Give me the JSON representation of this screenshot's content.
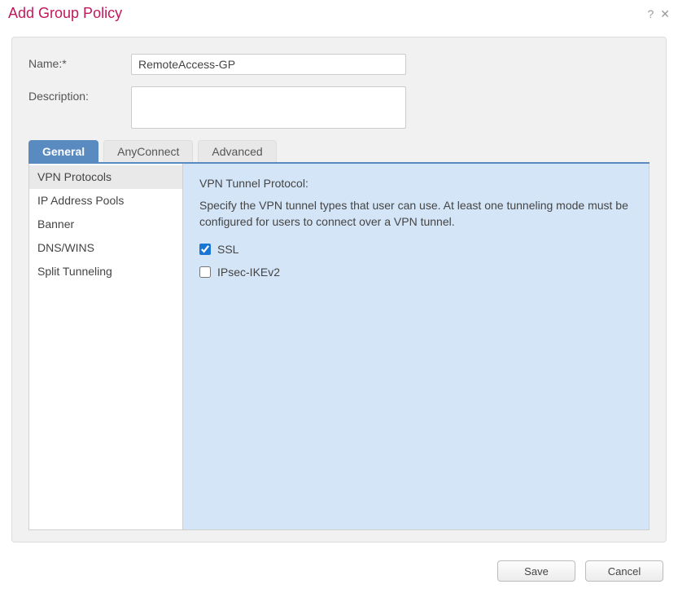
{
  "dialog": {
    "title": "Add Group Policy"
  },
  "form": {
    "name": {
      "label": "Name:*",
      "value": "RemoteAccess-GP"
    },
    "description": {
      "label": "Description:",
      "value": ""
    }
  },
  "tabs": [
    {
      "label": "General",
      "active": true
    },
    {
      "label": "AnyConnect",
      "active": false
    },
    {
      "label": "Advanced",
      "active": false
    }
  ],
  "sidebar": {
    "items": [
      {
        "label": "VPN Protocols",
        "selected": true
      },
      {
        "label": "IP Address Pools",
        "selected": false
      },
      {
        "label": "Banner",
        "selected": false
      },
      {
        "label": "DNS/WINS",
        "selected": false
      },
      {
        "label": "Split Tunneling",
        "selected": false
      }
    ]
  },
  "content": {
    "heading": "VPN Tunnel Protocol:",
    "description": "Specify the VPN tunnel types that user can use. At least one tunneling mode must be configured for users to connect over a VPN tunnel.",
    "options": [
      {
        "label": "SSL",
        "checked": true
      },
      {
        "label": "IPsec-IKEv2",
        "checked": false
      }
    ]
  },
  "buttons": {
    "save": "Save",
    "cancel": "Cancel"
  }
}
